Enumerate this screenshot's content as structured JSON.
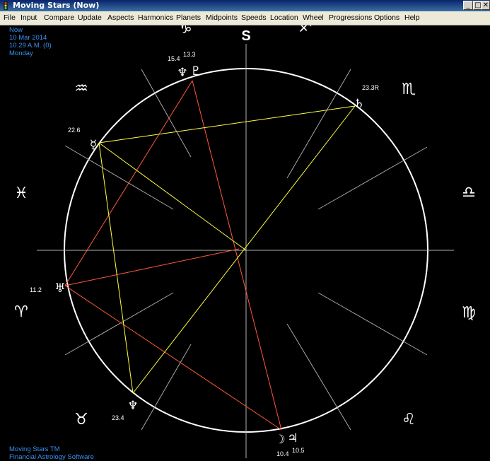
{
  "window": {
    "title": "Moving Stars (Now)"
  },
  "menu": [
    "File",
    "Input",
    "Compare",
    "Update",
    "Aspects",
    "Harmonics",
    "Planets",
    "Midpoints",
    "Speeds",
    "Location",
    "Wheel",
    "Progressions",
    "Options",
    "Help"
  ],
  "info": {
    "line1": "Now",
    "line2": "10 Mar 2014",
    "line3": "10.29 A.M. (0)",
    "line4": "Monday"
  },
  "footer": {
    "line1": "Moving Stars TM",
    "line2": "Financial Astrology Software"
  },
  "wheel": {
    "south_label": "S",
    "zodiac": {
      "capricorn": "♑",
      "sagittarius": "♐",
      "aquarius": "♒",
      "scorpio": "♏",
      "pisces": "♓",
      "libra": "♎",
      "aries": "♈",
      "virgo": "♍",
      "taurus": "♉",
      "leo": "♌"
    },
    "planets": {
      "neptune_deg": "15.4",
      "pluto_deg": "13.3",
      "neptune": "♆",
      "pluto": "♇",
      "saturn": "♄",
      "saturn_deg": "23.3R",
      "mercury": "☿",
      "mercury_deg": "22.6",
      "uranus": "♅",
      "uranus_deg": "11.2",
      "neptune2": "♆",
      "neptune2_deg": "23.4",
      "moon": "☽",
      "moon_deg": "10.4",
      "jupiter": "♃",
      "jupiter_deg": "10.5"
    },
    "colors": {
      "red": "#ff5a3c",
      "yellow": "#ffff40",
      "grey": "#a0a0a0"
    }
  }
}
